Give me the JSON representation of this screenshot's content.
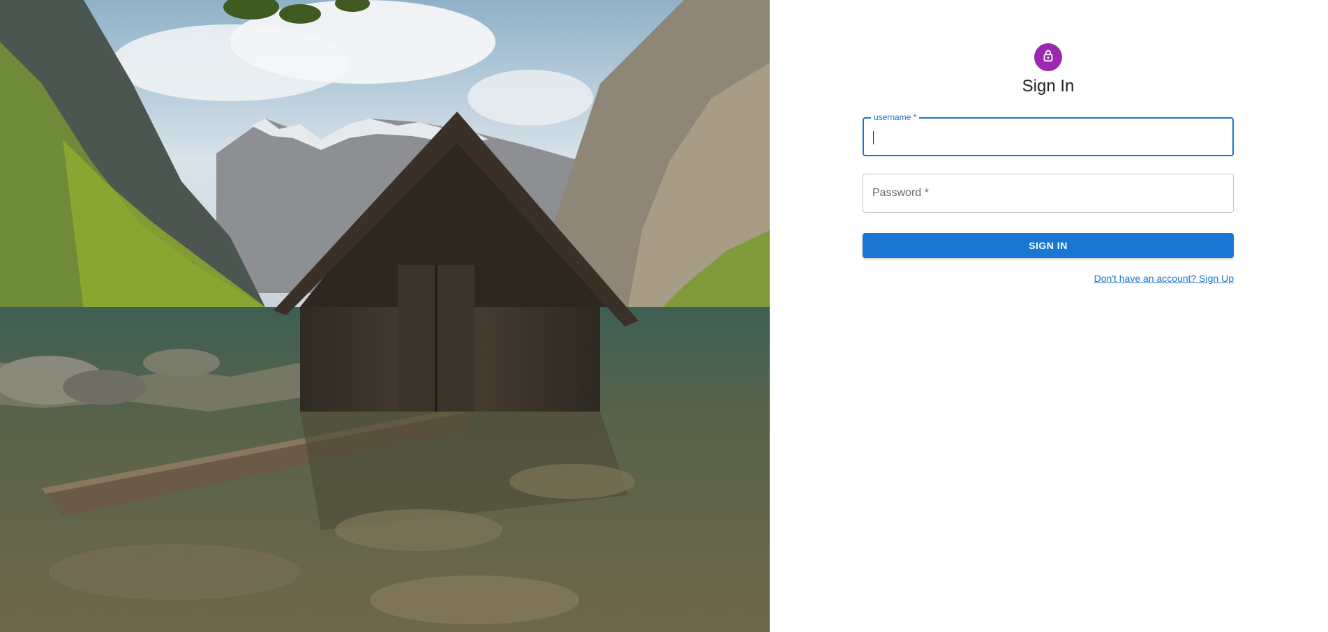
{
  "hero": {
    "icon": "lakeside-boathouse-photo"
  },
  "auth": {
    "avatar_icon": "lock-icon",
    "avatar_color": "#9c27b0",
    "title": "Sign In",
    "username": {
      "label": "username *",
      "value": ""
    },
    "password": {
      "label": "Password *",
      "value": ""
    },
    "submit_label": "SIGN IN",
    "signup_link": "Don't have an account? Sign Up"
  },
  "colors": {
    "primary": "#1976d2",
    "avatar": "#9c27b0"
  }
}
